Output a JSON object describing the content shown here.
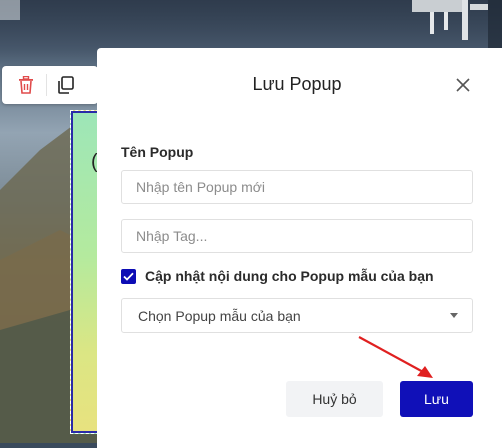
{
  "toolbar": {
    "icons": [
      "trash-icon",
      "copy-icon"
    ]
  },
  "popup_element": {
    "visible_glyph": "("
  },
  "modal": {
    "title": "Lưu Popup",
    "close_icon": "close-icon",
    "name_label": "Tên Popup",
    "name_input": {
      "value": "",
      "placeholder": "Nhập tên Popup mới"
    },
    "tag_input": {
      "value": "",
      "placeholder": "Nhập Tag..."
    },
    "update_checkbox": {
      "checked": true,
      "label": "Cập nhật nội dung cho Popup mẫu của bạn"
    },
    "template_select": {
      "selected": "Chọn Popup mẫu của bạn"
    },
    "cancel_label": "Huỷ bỏ",
    "save_label": "Lưu"
  },
  "colors": {
    "primary": "#1010b8",
    "checkbox": "#0c0cb5",
    "trash_icon": "#e04b4b",
    "annotation_arrow": "#e02020"
  }
}
